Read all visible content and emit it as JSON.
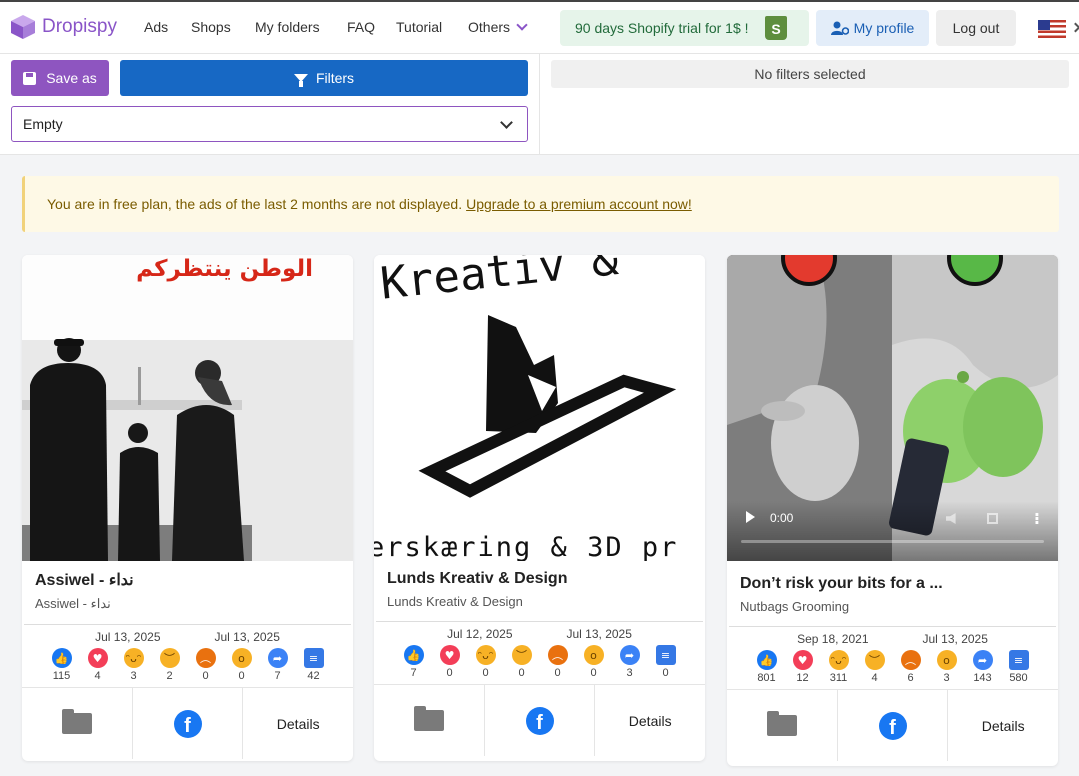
{
  "app": {
    "name": "Dropispy"
  },
  "nav": {
    "items": [
      "Ads",
      "Shops",
      "My folders",
      "FAQ",
      "Tutorial",
      "Others"
    ]
  },
  "header": {
    "promo_label": "90 days Shopify trial for 1$ !",
    "profile_label": "My profile",
    "logout_label": "Log out"
  },
  "filters": {
    "save_label": "Save as",
    "filters_label": "Filters",
    "select_value": "Empty",
    "status_text": "No filters selected"
  },
  "alert": {
    "text": "You are in free plan, the ads of the last 2 months are not displayed.",
    "link_text": "Upgrade to a premium account now!"
  },
  "cards": [
    {
      "title": "Assiwel - نداء",
      "subtitle": "Assiwel - نداء",
      "date_start": "Jul 13, 2025",
      "date_end": "Jul 13, 2025",
      "media_text": "الوطن ينتظركم",
      "reactions": [
        "115",
        "4",
        "3",
        "2",
        "0",
        "0",
        "7",
        "42"
      ],
      "details_label": "Details"
    },
    {
      "title": "Lunds Kreativ & Design",
      "subtitle": "Lunds Kreativ & Design",
      "date_start": "Jul 12, 2025",
      "date_end": "Jul 13, 2025",
      "media_top": "Kreativ &",
      "media_bottom": "erskæring & 3D pr",
      "reactions": [
        "7",
        "0",
        "0",
        "0",
        "0",
        "0",
        "3",
        "0"
      ],
      "details_label": "Details"
    },
    {
      "title": "Don’t risk your bits for a ...",
      "subtitle": "Nutbags Grooming",
      "date_start": "Sep 18, 2021",
      "date_end": "Jul 13, 2025",
      "video_time": "0:00",
      "reactions": [
        "801",
        "12",
        "311",
        "4",
        "6",
        "3",
        "143",
        "580"
      ],
      "details_label": "Details"
    }
  ],
  "colors": {
    "brand": "#8a55c8",
    "primary": "#1768c4",
    "facebook": "#1877f2",
    "alert_bg": "#fef9e6"
  }
}
